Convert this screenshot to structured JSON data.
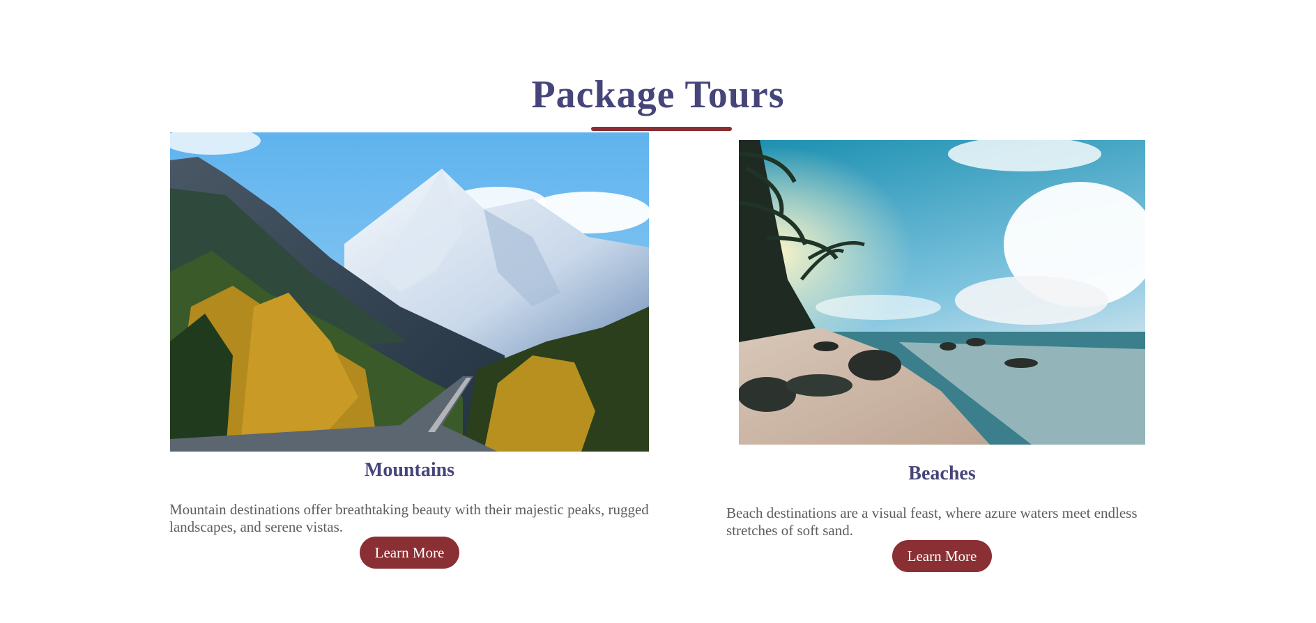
{
  "section": {
    "title": "Package Tours"
  },
  "colors": {
    "heading": "#46457a",
    "accent": "#8a3034",
    "body_text": "#5d5d5d"
  },
  "cards": [
    {
      "image": "mountain-landscape-photo",
      "title": "Mountains",
      "description": "Mountain destinations offer breathtaking beauty with their majestic peaks, rugged landscapes, and serene vistas.",
      "button_label": "Learn More"
    },
    {
      "image": "beach-landscape-photo",
      "title": "Beaches",
      "description": "Beach destinations are a visual feast, where azure waters meet endless stretches of soft sand.",
      "button_label": "Learn More"
    }
  ]
}
